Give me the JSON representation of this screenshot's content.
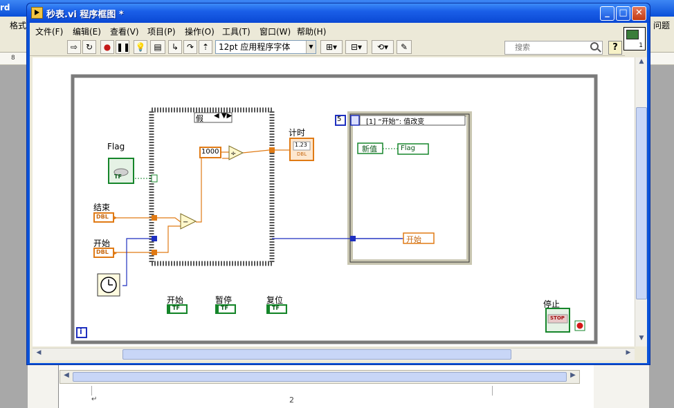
{
  "background_app": {
    "title_fragment": "rd",
    "menu_fragment_left": "格式",
    "menu_fragment_right": "问题",
    "ruler_value": "8",
    "page_mark": "↵",
    "page_number": "2"
  },
  "window": {
    "title": "秒表.vi 程序框图 *",
    "controls": {
      "minimize": "_",
      "maximize": "□",
      "close": "✕"
    }
  },
  "menu": [
    "文件(F)",
    "编辑(E)",
    "查看(V)",
    "项目(P)",
    "操作(O)",
    "工具(T)",
    "窗口(W)",
    "帮助(H)"
  ],
  "toolbar": {
    "font": "12pt 应用程序字体",
    "search_placeholder": "搜索",
    "help": "?",
    "vi_icon_number": "1"
  },
  "diagram": {
    "case_selector": "假",
    "constant_1000": "1000",
    "timer_indicator_label": "计时",
    "timer_indicator_value": "1.23",
    "timer_indicator_type": "DBL",
    "flag_label": "Flag",
    "end_label": "结束",
    "start_label": "开始",
    "dbl_type": "DBL",
    "tf_type": "TF",
    "event_count": "5",
    "event_case": "[1] “开始”: 值改变",
    "new_value": "新值",
    "flag_local": "Flag",
    "start_local": "开始",
    "button_start": "开始",
    "button_pause": "暂停",
    "button_reset": "复位",
    "stop_label": "停止",
    "stop_button": "STOP",
    "info": "i"
  },
  "colors": {
    "frame_gray": "#7b7b7b",
    "bool_green": "#15852a",
    "numeric_orange": "#e07a14",
    "int_blue": "#1e2fbf"
  }
}
